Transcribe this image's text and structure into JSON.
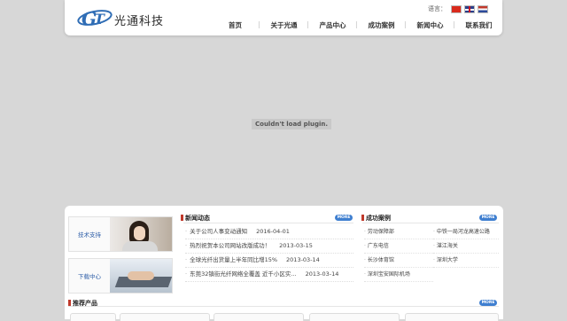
{
  "header": {
    "logo_text": "光通科技",
    "language_label": "语言：",
    "flags": [
      "flag-cn-icon",
      "flag-uk-icon",
      "flag-nl-icon"
    ],
    "nav": [
      "首页",
      "关于光通",
      "产品中心",
      "成功案例",
      "新闻中心",
      "联系我们"
    ]
  },
  "plugin": {
    "message": "Couldn't load plugin."
  },
  "side": {
    "support_label": "技术支持",
    "download_label": "下载中心"
  },
  "news": {
    "title": "新闻动态",
    "more": "MORE",
    "items": [
      {
        "text": "关于公司人事变动通知",
        "date": "2016-04-01"
      },
      {
        "text": "热烈祝贺本公司网站改版成功！",
        "date": "2013-03-15"
      },
      {
        "text": "全球光纤出货量上半年同比增15%",
        "date": "2013-03-14"
      },
      {
        "text": "东莞32镇街光纤网络全覆盖 近千小区实...",
        "date": "2013-03-14"
      }
    ]
  },
  "cases": {
    "title": "成功案例",
    "more": "MORE",
    "items": [
      "劳动保障部",
      "中铁一局河龙高速公路",
      "广东电信",
      "湛江海关",
      "长沙体育馆",
      "深圳大学",
      "深圳宝安国际机场"
    ]
  },
  "products": {
    "title": "推荐产品",
    "more": "MORE"
  },
  "colors": {
    "accent_blue": "#3f7fd0",
    "marker_red": "#c0392b",
    "background": "#d7d7d7"
  }
}
